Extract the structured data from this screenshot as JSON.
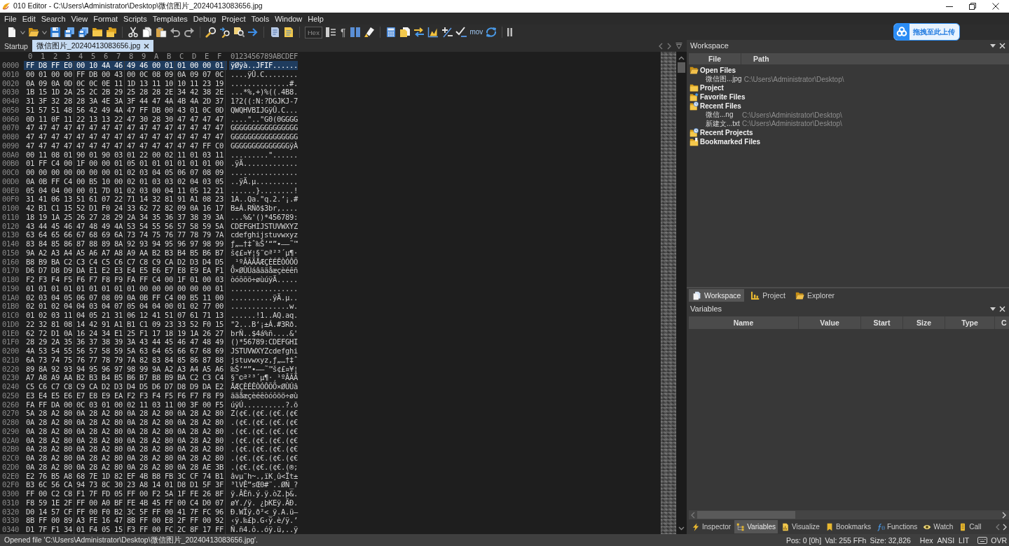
{
  "window": {
    "title": "010 Editor - C:\\Users\\Administrator\\Desktop\\微信图片_20240413083656.jpg"
  },
  "menu": [
    "File",
    "Edit",
    "Search",
    "View",
    "Format",
    "Scripts",
    "Templates",
    "Debug",
    "Project",
    "Tools",
    "Window",
    "Help"
  ],
  "toolbar": {
    "hex_button": "Hex",
    "whitespace_button": "¶",
    "mov_button": "mov"
  },
  "upload_badge": {
    "label": "拖拽至此上传"
  },
  "editor_tabs": [
    {
      "label": "Startup",
      "selected": false
    },
    {
      "label": "微信图片_20240413083656.jpg",
      "selected": true
    }
  ],
  "hex_view": {
    "column_headers": [
      "0",
      "1",
      "2",
      "3",
      "4",
      "5",
      "6",
      "7",
      "8",
      "9",
      "A",
      "B",
      "C",
      "D",
      "E",
      "F"
    ],
    "ascii_header": "0123456789ABCDEF",
    "rows": [
      {
        "address": "0000",
        "bytes": "FF D8 FF E0 00 10 4A 46 49 46 00 01 01 00 00 01",
        "ascii": "ÿØÿà..JFIF......",
        "selected": true
      },
      {
        "address": "0010",
        "bytes": "00 01 00 00 FF DB 00 43 00 0C 08 09 0A 09 07 0C",
        "ascii": "....ÿÛ.C........",
        "selected": false
      },
      {
        "address": "0020",
        "bytes": "0A 09 0A 0D 0C 0C 0E 11 1D 13 11 10 10 11 23 19",
        "ascii": "..............#.",
        "selected": false
      },
      {
        "address": "0030",
        "bytes": "1B 15 1D 2A 25 2C 2B 29 25 28 28 2E 34 42 38 2E",
        "ascii": "...*%,+)%((.4B8.",
        "selected": false
      },
      {
        "address": "0040",
        "bytes": "31 3F 32 28 28 3A 4E 3A 3F 44 47 4A 4B 4A 2D 37",
        "ascii": "1?2((:N:?DGJKJ-7",
        "selected": false
      },
      {
        "address": "0050",
        "bytes": "51 57 51 48 56 42 49 4A 47 FF DB 00 43 01 0C 0D",
        "ascii": "QWQHVBIJGÿÛ.C...",
        "selected": false
      },
      {
        "address": "0060",
        "bytes": "0D 11 0F 11 22 13 13 22 47 30 28 30 47 47 47 47",
        "ascii": "....\"..\"G0(0GGGG",
        "selected": false
      },
      {
        "address": "0070",
        "bytes": "47 47 47 47 47 47 47 47 47 47 47 47 47 47 47 47",
        "ascii": "GGGGGGGGGGGGGGGG",
        "selected": false
      },
      {
        "address": "0080",
        "bytes": "47 47 47 47 47 47 47 47 47 47 47 47 47 47 47 47",
        "ascii": "GGGGGGGGGGGGGGGG",
        "selected": false
      },
      {
        "address": "0090",
        "bytes": "47 47 47 47 47 47 47 47 47 47 47 47 47 47 FF C0",
        "ascii": "GGGGGGGGGGGGGGÿÀ",
        "selected": false
      },
      {
        "address": "00A0",
        "bytes": "00 11 08 01 90 01 90 03 01 22 00 02 11 01 03 11",
        "ascii": ".........\"......",
        "selected": false
      },
      {
        "address": "00B0",
        "bytes": "01 FF C4 00 1F 00 00 01 05 01 01 01 01 01 01 00",
        "ascii": ".ÿÄ.............",
        "selected": false
      },
      {
        "address": "00C0",
        "bytes": "00 00 00 00 00 00 00 01 02 03 04 05 06 07 08 09",
        "ascii": "................",
        "selected": false
      },
      {
        "address": "00D0",
        "bytes": "0A 0B FF C4 00 B5 10 00 02 01 03 03 02 04 03 05",
        "ascii": "..ÿÄ.µ..........",
        "selected": false
      },
      {
        "address": "00E0",
        "bytes": "05 04 04 00 00 01 7D 01 02 03 00 04 11 05 12 21",
        "ascii": "......}........!",
        "selected": false
      },
      {
        "address": "00F0",
        "bytes": "31 41 06 13 51 61 07 22 71 14 32 81 91 A1 08 23",
        "ascii": "1A..Qa.\"q.2.‘¡.#",
        "selected": false
      },
      {
        "address": "0100",
        "bytes": "42 B1 C1 15 52 D1 F0 24 33 62 72 82 09 0A 16 17",
        "ascii": "B±Á.RÑð$3br‚....",
        "selected": false
      },
      {
        "address": "0110",
        "bytes": "18 19 1A 25 26 27 28 29 2A 34 35 36 37 38 39 3A",
        "ascii": "...%&'()*456789:",
        "selected": false
      },
      {
        "address": "0120",
        "bytes": "43 44 45 46 47 48 49 4A 53 54 55 56 57 58 59 5A",
        "ascii": "CDEFGHIJSTUVWXYZ",
        "selected": false
      },
      {
        "address": "0130",
        "bytes": "63 64 65 66 67 68 69 6A 73 74 75 76 77 78 79 7A",
        "ascii": "cdefghijstuvwxyz",
        "selected": false
      },
      {
        "address": "0140",
        "bytes": "83 84 85 86 87 88 89 8A 92 93 94 95 96 97 98 99",
        "ascii": "ƒ„…†‡ˆ‰Š’“”•–—˜™",
        "selected": false
      },
      {
        "address": "0150",
        "bytes": "9A A2 A3 A4 A5 A6 A7 A8 A9 AA B2 B3 B4 B5 B6 B7",
        "ascii": "š¢£¤¥¦§¨©ª²³´µ¶·",
        "selected": false
      },
      {
        "address": "0160",
        "bytes": "B8 B9 BA C2 C3 C4 C5 C6 C7 C8 C9 CA D2 D3 D4 D5",
        "ascii": "¸¹ºÂÃÄÅÆÇÈÉÊÒÓÔÕ",
        "selected": false
      },
      {
        "address": "0170",
        "bytes": "D6 D7 D8 D9 DA E1 E2 E3 E4 E5 E6 E7 E8 E9 EA F1",
        "ascii": "Ö×ØÙÚáâãäåæçèéêñ",
        "selected": false
      },
      {
        "address": "0180",
        "bytes": "F2 F3 F4 F5 F6 F7 F8 F9 FA FF C4 00 1F 01 00 03",
        "ascii": "òóôõö÷øùúÿÄ.....",
        "selected": false
      },
      {
        "address": "0190",
        "bytes": "01 01 01 01 01 01 01 01 01 00 00 00 00 00 00 01",
        "ascii": "................",
        "selected": false
      },
      {
        "address": "01A0",
        "bytes": "02 03 04 05 06 07 08 09 0A 0B FF C4 00 B5 11 00",
        "ascii": "..........ÿÄ.µ..",
        "selected": false
      },
      {
        "address": "01B0",
        "bytes": "02 01 02 04 04 03 04 07 05 04 04 00 01 02 77 00",
        "ascii": "..............w.",
        "selected": false
      },
      {
        "address": "01C0",
        "bytes": "01 02 03 11 04 05 21 31 06 12 41 51 07 61 71 13",
        "ascii": "......!1..AQ.aq.",
        "selected": false
      },
      {
        "address": "01D0",
        "bytes": "22 32 81 08 14 42 91 A1 B1 C1 09 23 33 52 F0 15",
        "ascii": "\"2...B‘¡±Á.#3Rð.",
        "selected": false
      },
      {
        "address": "01E0",
        "bytes": "62 72 D1 0A 16 24 34 E1 25 F1 17 18 19 1A 26 27",
        "ascii": "brÑ..$4á%ñ....&'",
        "selected": false
      },
      {
        "address": "01F0",
        "bytes": "28 29 2A 35 36 37 38 39 3A 43 44 45 46 47 48 49",
        "ascii": "()*56789:CDEFGHI",
        "selected": false
      },
      {
        "address": "0200",
        "bytes": "4A 53 54 55 56 57 58 59 5A 63 64 65 66 67 68 69",
        "ascii": "JSTUVWXYZcdefghi",
        "selected": false
      },
      {
        "address": "0210",
        "bytes": "6A 73 74 75 76 77 78 79 7A 82 83 84 85 86 87 88",
        "ascii": "jstuvwxyz‚ƒ„…†‡ˆ",
        "selected": false
      },
      {
        "address": "0220",
        "bytes": "89 8A 92 93 94 95 96 97 98 99 9A A2 A3 A4 A5 A6",
        "ascii": "‰Š’“”•–—˜™š¢£¤¥¦",
        "selected": false
      },
      {
        "address": "0230",
        "bytes": "A7 A8 A9 AA B2 B3 B4 B5 B6 B7 B8 B9 BA C2 C3 C4",
        "ascii": "§¨©ª²³´µ¶·¸¹ºÂÃÄ",
        "selected": false
      },
      {
        "address": "0240",
        "bytes": "C5 C6 C7 C8 C9 CA D2 D3 D4 D5 D6 D7 D8 D9 DA E2",
        "ascii": "ÅÆÇÈÉÊÒÓÔÕÖ×ØÙÚâ",
        "selected": false
      },
      {
        "address": "0250",
        "bytes": "E3 E4 E5 E6 E7 E8 E9 EA F2 F3 F4 F5 F6 F7 F8 F9",
        "ascii": "ãäåæçèéêòóôõö÷øù",
        "selected": false
      },
      {
        "address": "0260",
        "bytes": "FA FF DA 00 0C 03 01 00 02 11 03 11 00 3F 00 F5",
        "ascii": "úÿÚ..........?.õ",
        "selected": false
      },
      {
        "address": "0270",
        "bytes": "5A 28 A2 80 0A 28 A2 80 0A 28 A2 80 0A 28 A2 80",
        "ascii": "Z(¢€.(¢€.(¢€.(¢€",
        "selected": false
      },
      {
        "address": "0280",
        "bytes": "0A 28 A2 80 0A 28 A2 80 0A 28 A2 80 0A 28 A2 80",
        "ascii": ".(¢€.(¢€.(¢€.(¢€",
        "selected": false
      },
      {
        "address": "0290",
        "bytes": "0A 28 A2 80 0A 28 A2 80 0A 28 A2 80 0A 28 A2 80",
        "ascii": ".(¢€.(¢€.(¢€.(¢€",
        "selected": false
      },
      {
        "address": "02A0",
        "bytes": "0A 28 A2 80 0A 28 A2 80 0A 28 A2 80 0A 28 A2 80",
        "ascii": ".(¢€.(¢€.(¢€.(¢€",
        "selected": false
      },
      {
        "address": "02B0",
        "bytes": "0A 28 A2 80 0A 28 A2 80 0A 28 A2 80 0A 28 A2 80",
        "ascii": ".(¢€.(¢€.(¢€.(¢€",
        "selected": false
      },
      {
        "address": "02C0",
        "bytes": "0A 28 A2 80 0A 28 A2 80 0A 28 A2 80 0A 28 A2 80",
        "ascii": ".(¢€.(¢€.(¢€.(¢€",
        "selected": false
      },
      {
        "address": "02D0",
        "bytes": "0A 28 A2 80 0A 28 A2 80 0A 28 A2 80 0A 28 AE 3B",
        "ascii": ".(¢€.(¢€.(¢€.(®;",
        "selected": false
      },
      {
        "address": "02E0",
        "bytes": "E2 76 B5 A8 68 7E 1D 82 EF 4B B8 FB 3C CF 74 B1",
        "ascii": "âvµ¨h~.‚ïK¸û<Ït±",
        "selected": false
      },
      {
        "address": "02F0",
        "bytes": "B3 6C 56 CA 94 73 8C 30 23 A8 14 01 D8 D1 5F 3F",
        "ascii": "³lVÊ”sŒ0#¨..ØÑ_?",
        "selected": false
      },
      {
        "address": "0300",
        "bytes": "FF 00 C2 C8 F1 7F FD 05 FF 00 F2 5A 1F FE 26 8F",
        "ascii": "ÿ.ÂÈñ.ý.ÿ.òZ.þ&.",
        "selected": false
      },
      {
        "address": "0310",
        "bytes": "F8 59 1E 2F FF 00 A0 BF FE 4B 45 FF 00 C4 D0 07",
        "ascii": "øY./ÿ. ¿þKEÿ.ÄÐ.",
        "selected": false
      },
      {
        "address": "0320",
        "bytes": "D0 14 57 CF FF 00 F0 B2 3C 5F FF 00 41 7F FC 96",
        "ascii": "Ð.WÏÿ.ð²<_ÿ.A.ü–",
        "selected": false
      },
      {
        "address": "0330",
        "bytes": "8B FF 00 89 A3 FE 16 47 8B FF 00 E8 2F FF 00 92",
        "ascii": "‹ÿ.‰£þ.G‹ÿ.è/ÿ.’",
        "selected": false
      },
      {
        "address": "0340",
        "bytes": "D1 7F F1 34 01 F4 05 15 F3 FF 00 FC 2C 8F 17 FF",
        "ascii": "Ñ.ñ4.ô..óÿ.ü,..ÿ",
        "selected": false
      }
    ]
  },
  "workspace": {
    "title": "Workspace",
    "columns": [
      "File",
      "Path"
    ],
    "tree": [
      {
        "label": "Open Files",
        "kind": "open",
        "children": [
          {
            "file": "微信图...jpg",
            "path": "C:\\Users\\Administrator\\Desktop\\"
          }
        ]
      },
      {
        "label": "Project",
        "kind": "project"
      },
      {
        "label": "Favorite Files",
        "kind": "favorites"
      },
      {
        "label": "Recent Files",
        "kind": "recent",
        "children": [
          {
            "file": "微信...ng",
            "path": "C:\\Users\\Administrator\\Desktop\\"
          },
          {
            "file": "新建文...txt",
            "path": "C:\\Users\\Administrator\\Desktop\\"
          }
        ]
      },
      {
        "label": "Recent Projects",
        "kind": "recent"
      },
      {
        "label": "Bookmarked Files",
        "kind": "bookmarks"
      }
    ]
  },
  "panel_tabs": [
    {
      "label": "Workspace",
      "kind": "workspace",
      "selected": true
    },
    {
      "label": "Project",
      "kind": "project",
      "selected": false
    },
    {
      "label": "Explorer",
      "kind": "explorer",
      "selected": false
    }
  ],
  "variables": {
    "title": "Variables",
    "columns": [
      "Name",
      "Value",
      "Start",
      "Size",
      "Type",
      "C"
    ]
  },
  "bottom_tabs": [
    {
      "label": "Inspector",
      "kind": "inspector",
      "selected": false
    },
    {
      "label": "Variables",
      "kind": "variables",
      "selected": true
    },
    {
      "label": "Visualize",
      "kind": "visualize",
      "selected": false
    },
    {
      "label": "Bookmarks",
      "kind": "bookmarks",
      "selected": false
    },
    {
      "label": "Functions",
      "kind": "functions",
      "selected": false
    },
    {
      "label": "Watch",
      "kind": "watch",
      "selected": false
    },
    {
      "label": "Call",
      "kind": "call",
      "selected": false
    }
  ],
  "status_bar": {
    "message": "Opened file 'C:\\Users\\Administrator\\Desktop\\微信图片_20240413083656.jpg'.",
    "position": "Pos: 0 [0h]",
    "value": "Val: 255 FFh",
    "size": "Size: 32,826",
    "mode": "Hex",
    "encoding": "ANSI",
    "byte_order": "LIT",
    "insert_mode": "OVR"
  }
}
